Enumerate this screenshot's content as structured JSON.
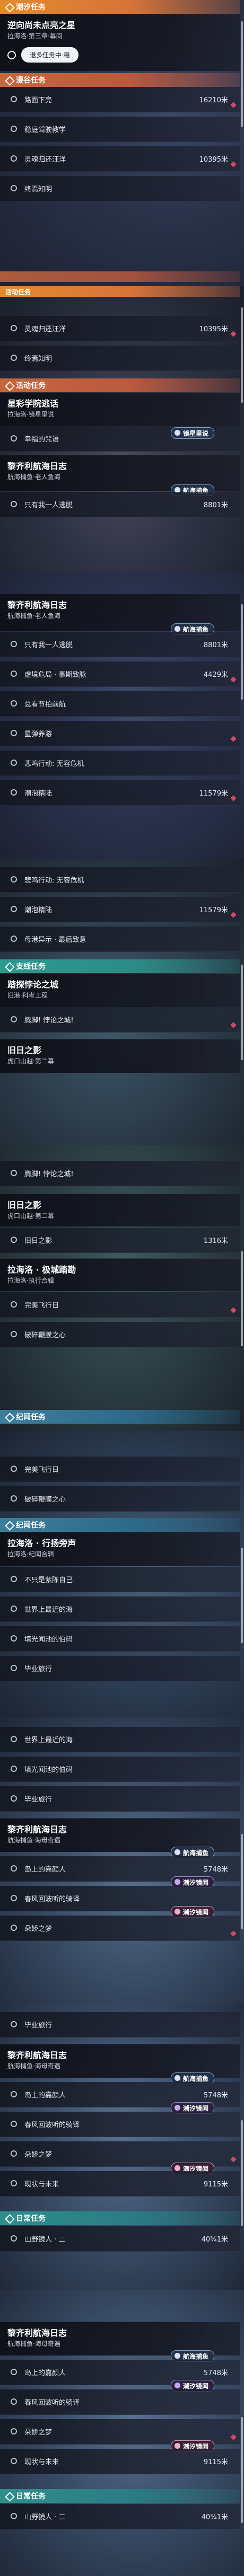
{
  "colors": {
    "main_header": "#e38a2c",
    "event_header": "#c6663d",
    "side_header": "#2b9a8f",
    "connect_header": "#3c7f9c",
    "daily_header": "#2f8e8b",
    "alert_diamond": "#d04a62"
  },
  "screens": [
    {
      "main_header": "潮汐任务",
      "card_title": "逆向尚未点亮之星",
      "card_sub": "拉海洛·第三章·幕间",
      "pill": "退多任务中·稳",
      "event_header": "漫谷任务",
      "rows": [
        {
          "label": "路面下亮",
          "value": "16210米"
        },
        {
          "label": "稳庭驾驶教学",
          "value": ""
        },
        {
          "label": "灵魂归还汪洋",
          "value": "10395米"
        },
        {
          "label": "终焉知明",
          "value": ""
        }
      ]
    },
    {
      "main_header": "活动任务",
      "rows_top": [
        {
          "label": "灵魂归还汪洋",
          "value": "10395米"
        },
        {
          "label": "终焉知明",
          "value": ""
        }
      ],
      "event_header": "活动任务",
      "card1_title": "星彩学院逃话",
      "card1_sub": "拉海洛·镜星里说",
      "card1_row": "幸福的咒语",
      "card1_tag": "镜星里说",
      "card2_title": "黎齐利航海日志",
      "card2_sub": "航海捕鱼·老人鱼海",
      "card2_tag": "航海捕鱼",
      "card2_row": "只有我一人逃脱",
      "card2_value": "8801米"
    },
    {
      "card_title": "黎齐利航海日志",
      "card_sub": "航海捕鱼·老人鱼海",
      "card_tag": "航海捕鱼",
      "rows": [
        {
          "label": "只有我一人逃脱",
          "value": "8801米"
        },
        {
          "label": "虚境危局 · 事期致脉",
          "value": "4429米"
        },
        {
          "label": "总看节拍前航",
          "value": ""
        },
        {
          "label": "星弹养游",
          "value": ""
        },
        {
          "label": "悲鸣行动: 无容危机",
          "value": ""
        },
        {
          "label": "潮泡精陆",
          "value": "11579米"
        }
      ]
    },
    {
      "rows_top": [
        {
          "label": "悲鸣行动: 无容危机",
          "value": ""
        },
        {
          "label": "潮泡精陆",
          "value": "11579米"
        },
        {
          "label": "母港异示 · 最后致意",
          "value": ""
        }
      ],
      "side_header": "支线任务",
      "card_title": "踏探悖论之城",
      "card_sub": "旧港·科考工程",
      "card_row": "腾脚! 悖论之城!",
      "card2_title": "旧日之影",
      "card2_sub": "虎口山越·第二幕"
    },
    {
      "card0_row": "腾脚! 悖论之城!",
      "card_title": "旧日之影",
      "card_sub": "虎口山越·第二幕",
      "row1": {
        "label": "旧日之影",
        "value": "1316米"
      },
      "card2_title": "拉海洛 · 极城踏勘",
      "card2_sub": "拉海洛·执行合辑",
      "rows": [
        {
          "label": "完美飞行日",
          "value": ""
        },
        {
          "label": "破碎鞭膜之心",
          "value": ""
        }
      ],
      "conn_header": "纪闻任务"
    },
    {
      "conn_header": "纪闻任务",
      "rows_top": [
        {
          "label": "完美飞行日",
          "value": ""
        },
        {
          "label": "破碎鞭膜之心",
          "value": ""
        }
      ],
      "card_title": "拉海洛 · 行扬旁声",
      "card_sub": "拉海洛·纪闻合辑",
      "rows": [
        {
          "label": "不只是紫陈自己",
          "value": ""
        },
        {
          "label": "世界上最近的海",
          "value": ""
        },
        {
          "label": "填光闻池的伯码",
          "value": ""
        },
        {
          "label": "毕业旅行",
          "value": ""
        }
      ]
    },
    {
      "rows_top": [
        {
          "label": "世界上最近的海",
          "value": ""
        },
        {
          "label": "填光闻池的伯码",
          "value": ""
        },
        {
          "label": "毕业旅行",
          "value": ""
        }
      ],
      "card_title": "黎齐利航海日志",
      "card_sub": "航海捕鱼·海母奇遇",
      "card_tag": "航海捕鱼",
      "rows": [
        {
          "label": "岛上的嘉颜人",
          "value": "5748米"
        },
        {
          "label": "春风回波听的骑译",
          "value": ""
        },
        {
          "label": "朵娇之梦",
          "value": ""
        }
      ],
      "tag2": "潮汐镜闻",
      "tag3": "潮汐镜闻"
    },
    {
      "row_top": {
        "label": "毕业旅行",
        "value": ""
      },
      "card_title": "黎齐利航海日志",
      "card_sub": "航海捕鱼·海母奇遇",
      "card_tag": "航海捕鱼",
      "rows": [
        {
          "label": "岛上的嘉颜人",
          "value": "5748米"
        },
        {
          "label": "春风回波听的骑译",
          "value": ""
        },
        {
          "label": "朵娇之梦",
          "value": ""
        },
        {
          "label": "现状与未来",
          "value": "9115米"
        }
      ],
      "tag2": "潮汐镜闻",
      "tag3": "潮汐镜闻",
      "daily_header": "日常任务",
      "daily_row": {
        "label": "山野镜人 · 二",
        "value": "40¾1米"
      }
    },
    {
      "card_title": "黎齐利航海日志",
      "card_sub": "航海捕鱼·海母奇遇",
      "card_tag": "航海捕鱼",
      "rows": [
        {
          "label": "岛上的嘉颜人",
          "value": "5748米"
        },
        {
          "label": "春风回波听的骑译",
          "value": ""
        },
        {
          "label": "朵娇之梦",
          "value": ""
        },
        {
          "label": "现状与未来",
          "value": "9115米"
        }
      ],
      "tag2": "潮汐镜闻",
      "tag3": "潮汐镜闻",
      "daily_header": "日常任务",
      "daily_row": {
        "label": "山野镜人 · 二",
        "value": "40¾1米"
      }
    }
  ]
}
